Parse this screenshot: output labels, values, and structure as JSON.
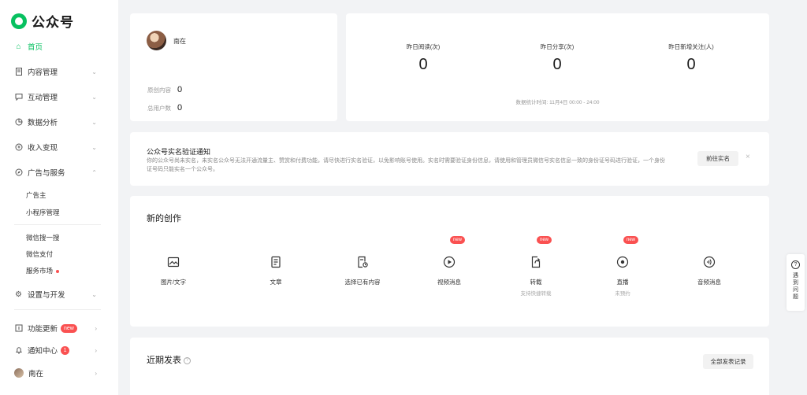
{
  "app": {
    "name": "公众号"
  },
  "sidebar": {
    "home": "首页",
    "content": "内容管理",
    "interact": "互动管理",
    "analysis": "数据分析",
    "income": "收入变现",
    "ads": "广告与服务",
    "ads_sub": [
      "广告主",
      "小程序管理"
    ],
    "ext": [
      "微信搜一搜",
      "微信支付",
      "服务市场"
    ],
    "settings": "设置与开发",
    "updates": "功能更新",
    "updates_badge": "new",
    "notify": "通知中心",
    "notify_count": "1",
    "user": "南在"
  },
  "profile": {
    "name": "南在",
    "original_label": "原创内容",
    "original_value": "0",
    "users_label": "总用户数",
    "users_value": "0"
  },
  "yesterday": {
    "metrics": [
      {
        "label": "昨日阅读(次)",
        "value": "0"
      },
      {
        "label": "昨日分享(次)",
        "value": "0"
      },
      {
        "label": "昨日新增关注(人)",
        "value": "0"
      }
    ],
    "time_note": "数据统计时间: 11月4日 00:00 - 24:00"
  },
  "notice": {
    "title": "公众号实名验证通知",
    "body": "你的公众号尚未实名，未实名公众号无法开通流量主、赞赏和付费功能，请尽快进行实名验证，以免影响账号使用。实名时需要验证身份信息，请使用和管理员微信号实名信息一致的身份证号码进行验证，一个身份证号码只能实名一个公众号。",
    "button": "前往实名",
    "close": "×"
  },
  "create": {
    "title": "新的创作",
    "items": [
      {
        "label": "图片/文字",
        "sub": "",
        "badge": "",
        "icon": "image-text-icon"
      },
      {
        "label": "文章",
        "sub": "",
        "badge": "",
        "icon": "article-icon"
      },
      {
        "label": "选择已有内容",
        "sub": "",
        "badge": "",
        "icon": "existing-content-icon"
      },
      {
        "label": "视频消息",
        "sub": "",
        "badge": "new",
        "icon": "video-icon"
      },
      {
        "label": "转载",
        "sub": "支持快捷转载",
        "badge": "new",
        "icon": "repost-icon"
      },
      {
        "label": "直播",
        "sub": "未预约",
        "badge": "new",
        "icon": "live-icon"
      },
      {
        "label": "音频消息",
        "sub": "",
        "badge": "",
        "icon": "audio-icon"
      }
    ]
  },
  "recent": {
    "title": "近期发表",
    "button": "全部发表记录"
  },
  "help": {
    "label": "遇到问题",
    "q": "?"
  }
}
